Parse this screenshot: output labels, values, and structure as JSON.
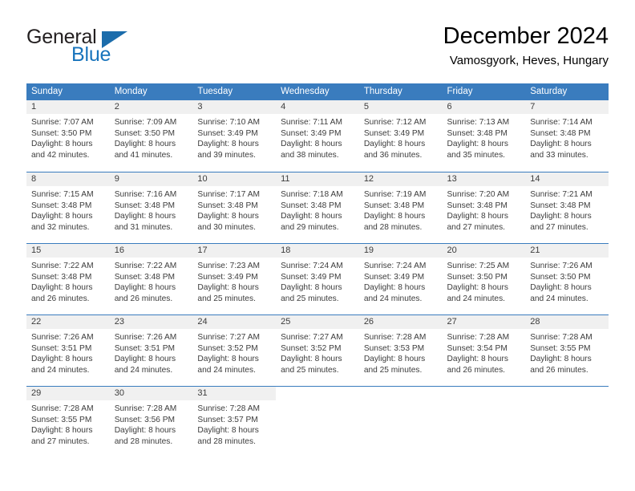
{
  "brand": {
    "name_part1": "General",
    "name_part2": "Blue",
    "logo_icon": "triangle-logo-icon",
    "accent_color": "#1b6cab"
  },
  "header": {
    "title": "December 2024",
    "subtitle": "Vamosgyork, Heves, Hungary"
  },
  "theme": {
    "header_row_bg": "#3a7cbe",
    "day_band_bg": "#f0f0f0",
    "separator_color": "#3a7cbe",
    "text_color": "#3c3c3c"
  },
  "calendar": {
    "day_headers": [
      "Sunday",
      "Monday",
      "Tuesday",
      "Wednesday",
      "Thursday",
      "Friday",
      "Saturday"
    ],
    "weeks": [
      [
        {
          "day": "1",
          "sunrise": "Sunrise: 7:07 AM",
          "sunset": "Sunset: 3:50 PM",
          "daylight_line1": "Daylight: 8 hours",
          "daylight_line2": "and 42 minutes."
        },
        {
          "day": "2",
          "sunrise": "Sunrise: 7:09 AM",
          "sunset": "Sunset: 3:50 PM",
          "daylight_line1": "Daylight: 8 hours",
          "daylight_line2": "and 41 minutes."
        },
        {
          "day": "3",
          "sunrise": "Sunrise: 7:10 AM",
          "sunset": "Sunset: 3:49 PM",
          "daylight_line1": "Daylight: 8 hours",
          "daylight_line2": "and 39 minutes."
        },
        {
          "day": "4",
          "sunrise": "Sunrise: 7:11 AM",
          "sunset": "Sunset: 3:49 PM",
          "daylight_line1": "Daylight: 8 hours",
          "daylight_line2": "and 38 minutes."
        },
        {
          "day": "5",
          "sunrise": "Sunrise: 7:12 AM",
          "sunset": "Sunset: 3:49 PM",
          "daylight_line1": "Daylight: 8 hours",
          "daylight_line2": "and 36 minutes."
        },
        {
          "day": "6",
          "sunrise": "Sunrise: 7:13 AM",
          "sunset": "Sunset: 3:48 PM",
          "daylight_line1": "Daylight: 8 hours",
          "daylight_line2": "and 35 minutes."
        },
        {
          "day": "7",
          "sunrise": "Sunrise: 7:14 AM",
          "sunset": "Sunset: 3:48 PM",
          "daylight_line1": "Daylight: 8 hours",
          "daylight_line2": "and 33 minutes."
        }
      ],
      [
        {
          "day": "8",
          "sunrise": "Sunrise: 7:15 AM",
          "sunset": "Sunset: 3:48 PM",
          "daylight_line1": "Daylight: 8 hours",
          "daylight_line2": "and 32 minutes."
        },
        {
          "day": "9",
          "sunrise": "Sunrise: 7:16 AM",
          "sunset": "Sunset: 3:48 PM",
          "daylight_line1": "Daylight: 8 hours",
          "daylight_line2": "and 31 minutes."
        },
        {
          "day": "10",
          "sunrise": "Sunrise: 7:17 AM",
          "sunset": "Sunset: 3:48 PM",
          "daylight_line1": "Daylight: 8 hours",
          "daylight_line2": "and 30 minutes."
        },
        {
          "day": "11",
          "sunrise": "Sunrise: 7:18 AM",
          "sunset": "Sunset: 3:48 PM",
          "daylight_line1": "Daylight: 8 hours",
          "daylight_line2": "and 29 minutes."
        },
        {
          "day": "12",
          "sunrise": "Sunrise: 7:19 AM",
          "sunset": "Sunset: 3:48 PM",
          "daylight_line1": "Daylight: 8 hours",
          "daylight_line2": "and 28 minutes."
        },
        {
          "day": "13",
          "sunrise": "Sunrise: 7:20 AM",
          "sunset": "Sunset: 3:48 PM",
          "daylight_line1": "Daylight: 8 hours",
          "daylight_line2": "and 27 minutes."
        },
        {
          "day": "14",
          "sunrise": "Sunrise: 7:21 AM",
          "sunset": "Sunset: 3:48 PM",
          "daylight_line1": "Daylight: 8 hours",
          "daylight_line2": "and 27 minutes."
        }
      ],
      [
        {
          "day": "15",
          "sunrise": "Sunrise: 7:22 AM",
          "sunset": "Sunset: 3:48 PM",
          "daylight_line1": "Daylight: 8 hours",
          "daylight_line2": "and 26 minutes."
        },
        {
          "day": "16",
          "sunrise": "Sunrise: 7:22 AM",
          "sunset": "Sunset: 3:48 PM",
          "daylight_line1": "Daylight: 8 hours",
          "daylight_line2": "and 26 minutes."
        },
        {
          "day": "17",
          "sunrise": "Sunrise: 7:23 AM",
          "sunset": "Sunset: 3:49 PM",
          "daylight_line1": "Daylight: 8 hours",
          "daylight_line2": "and 25 minutes."
        },
        {
          "day": "18",
          "sunrise": "Sunrise: 7:24 AM",
          "sunset": "Sunset: 3:49 PM",
          "daylight_line1": "Daylight: 8 hours",
          "daylight_line2": "and 25 minutes."
        },
        {
          "day": "19",
          "sunrise": "Sunrise: 7:24 AM",
          "sunset": "Sunset: 3:49 PM",
          "daylight_line1": "Daylight: 8 hours",
          "daylight_line2": "and 24 minutes."
        },
        {
          "day": "20",
          "sunrise": "Sunrise: 7:25 AM",
          "sunset": "Sunset: 3:50 PM",
          "daylight_line1": "Daylight: 8 hours",
          "daylight_line2": "and 24 minutes."
        },
        {
          "day": "21",
          "sunrise": "Sunrise: 7:26 AM",
          "sunset": "Sunset: 3:50 PM",
          "daylight_line1": "Daylight: 8 hours",
          "daylight_line2": "and 24 minutes."
        }
      ],
      [
        {
          "day": "22",
          "sunrise": "Sunrise: 7:26 AM",
          "sunset": "Sunset: 3:51 PM",
          "daylight_line1": "Daylight: 8 hours",
          "daylight_line2": "and 24 minutes."
        },
        {
          "day": "23",
          "sunrise": "Sunrise: 7:26 AM",
          "sunset": "Sunset: 3:51 PM",
          "daylight_line1": "Daylight: 8 hours",
          "daylight_line2": "and 24 minutes."
        },
        {
          "day": "24",
          "sunrise": "Sunrise: 7:27 AM",
          "sunset": "Sunset: 3:52 PM",
          "daylight_line1": "Daylight: 8 hours",
          "daylight_line2": "and 24 minutes."
        },
        {
          "day": "25",
          "sunrise": "Sunrise: 7:27 AM",
          "sunset": "Sunset: 3:52 PM",
          "daylight_line1": "Daylight: 8 hours",
          "daylight_line2": "and 25 minutes."
        },
        {
          "day": "26",
          "sunrise": "Sunrise: 7:28 AM",
          "sunset": "Sunset: 3:53 PM",
          "daylight_line1": "Daylight: 8 hours",
          "daylight_line2": "and 25 minutes."
        },
        {
          "day": "27",
          "sunrise": "Sunrise: 7:28 AM",
          "sunset": "Sunset: 3:54 PM",
          "daylight_line1": "Daylight: 8 hours",
          "daylight_line2": "and 26 minutes."
        },
        {
          "day": "28",
          "sunrise": "Sunrise: 7:28 AM",
          "sunset": "Sunset: 3:55 PM",
          "daylight_line1": "Daylight: 8 hours",
          "daylight_line2": "and 26 minutes."
        }
      ],
      [
        {
          "day": "29",
          "sunrise": "Sunrise: 7:28 AM",
          "sunset": "Sunset: 3:55 PM",
          "daylight_line1": "Daylight: 8 hours",
          "daylight_line2": "and 27 minutes."
        },
        {
          "day": "30",
          "sunrise": "Sunrise: 7:28 AM",
          "sunset": "Sunset: 3:56 PM",
          "daylight_line1": "Daylight: 8 hours",
          "daylight_line2": "and 28 minutes."
        },
        {
          "day": "31",
          "sunrise": "Sunrise: 7:28 AM",
          "sunset": "Sunset: 3:57 PM",
          "daylight_line1": "Daylight: 8 hours",
          "daylight_line2": "and 28 minutes."
        },
        {
          "day": "",
          "sunrise": "",
          "sunset": "",
          "daylight_line1": "",
          "daylight_line2": ""
        },
        {
          "day": "",
          "sunrise": "",
          "sunset": "",
          "daylight_line1": "",
          "daylight_line2": ""
        },
        {
          "day": "",
          "sunrise": "",
          "sunset": "",
          "daylight_line1": "",
          "daylight_line2": ""
        },
        {
          "day": "",
          "sunrise": "",
          "sunset": "",
          "daylight_line1": "",
          "daylight_line2": ""
        }
      ]
    ]
  }
}
